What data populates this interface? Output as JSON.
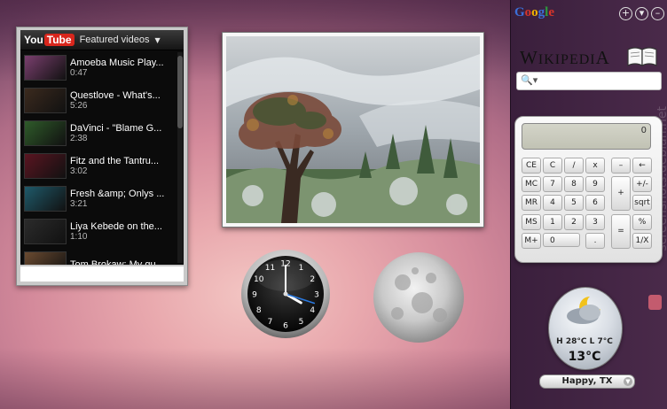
{
  "youtube": {
    "logo_you": "You",
    "logo_tube": "Tube",
    "title": "Featured videos",
    "videos": [
      {
        "title": "Amoeba Music Play...",
        "duration": "0:47",
        "thumb_color": "#7a3f6e"
      },
      {
        "title": "Questlove - What's...",
        "duration": "5:26",
        "thumb_color": "#3b2a1e"
      },
      {
        "title": "DaVinci - \"Blame G...",
        "duration": "2:38",
        "thumb_color": "#2f5b2a"
      },
      {
        "title": "Fitz and the Tantru...",
        "duration": "3:02",
        "thumb_color": "#5a1521"
      },
      {
        "title": "Fresh &amp; Onlys ...",
        "duration": "3:21",
        "thumb_color": "#1f5a6a"
      },
      {
        "title": "Liya Kebede on the...",
        "duration": "1:10",
        "thumb_color": "#2b2b2b"
      },
      {
        "title": "Tom Brokaw: My gu...",
        "duration": "",
        "thumb_color": "#6a4a30"
      }
    ]
  },
  "clock": {
    "hour": 4,
    "minute": 0,
    "second": 18,
    "numerals": [
      "12",
      "1",
      "2",
      "3",
      "4",
      "5",
      "6",
      "7",
      "8",
      "9",
      "10",
      "11"
    ]
  },
  "sidebar": {
    "google_letters": [
      {
        "ch": "G",
        "color": "#3b6fd8"
      },
      {
        "ch": "o",
        "color": "#d8352a"
      },
      {
        "ch": "o",
        "color": "#f0b400"
      },
      {
        "ch": "g",
        "color": "#3b6fd8"
      },
      {
        "ch": "l",
        "color": "#2e9a3d"
      },
      {
        "ch": "e",
        "color": "#d8352a"
      }
    ],
    "controls": [
      "+",
      "▾",
      "–"
    ],
    "watermark": "screenshots.debian.net"
  },
  "wikipedia": {
    "title_first": "W",
    "title_rest": "IKIPEDI",
    "title_last": "A",
    "search_value": ""
  },
  "calculator": {
    "display": "0",
    "keys": [
      {
        "label": "CE",
        "name": "calc-key-ce"
      },
      {
        "label": "C",
        "name": "calc-key-c"
      },
      {
        "label": "/",
        "name": "calc-key-divide"
      },
      {
        "label": "x",
        "name": "calc-key-multiply"
      },
      {
        "label": "–",
        "name": "calc-key-minus"
      },
      {
        "label": "←",
        "name": "calc-key-backspace"
      },
      {
        "label": "MC",
        "name": "calc-key-mc"
      },
      {
        "label": "7",
        "name": "calc-key-7"
      },
      {
        "label": "8",
        "name": "calc-key-8"
      },
      {
        "label": "9",
        "name": "calc-key-9"
      },
      {
        "label": "+",
        "name": "calc-key-plus"
      },
      {
        "label": "+/-",
        "name": "calc-key-negate"
      },
      {
        "label": "MR",
        "name": "calc-key-mr"
      },
      {
        "label": "4",
        "name": "calc-key-4"
      },
      {
        "label": "5",
        "name": "calc-key-5"
      },
      {
        "label": "6",
        "name": "calc-key-6"
      },
      {
        "label": "sqrt",
        "name": "calc-key-sqrt"
      },
      {
        "label": "MS",
        "name": "calc-key-ms"
      },
      {
        "label": "1",
        "name": "calc-key-1"
      },
      {
        "label": "2",
        "name": "calc-key-2"
      },
      {
        "label": "3",
        "name": "calc-key-3"
      },
      {
        "label": "=",
        "name": "calc-key-equals"
      },
      {
        "label": "%",
        "name": "calc-key-percent"
      },
      {
        "label": "M+",
        "name": "calc-key-mplus"
      },
      {
        "label": "0",
        "name": "calc-key-0"
      },
      {
        "label": ".",
        "name": "calc-key-decimal"
      },
      {
        "label": "1/X",
        "name": "calc-key-reciprocal"
      }
    ]
  },
  "weather": {
    "hilo": "H 28°C L 7°C",
    "temp": "13°C",
    "city": "Happy, TX"
  }
}
